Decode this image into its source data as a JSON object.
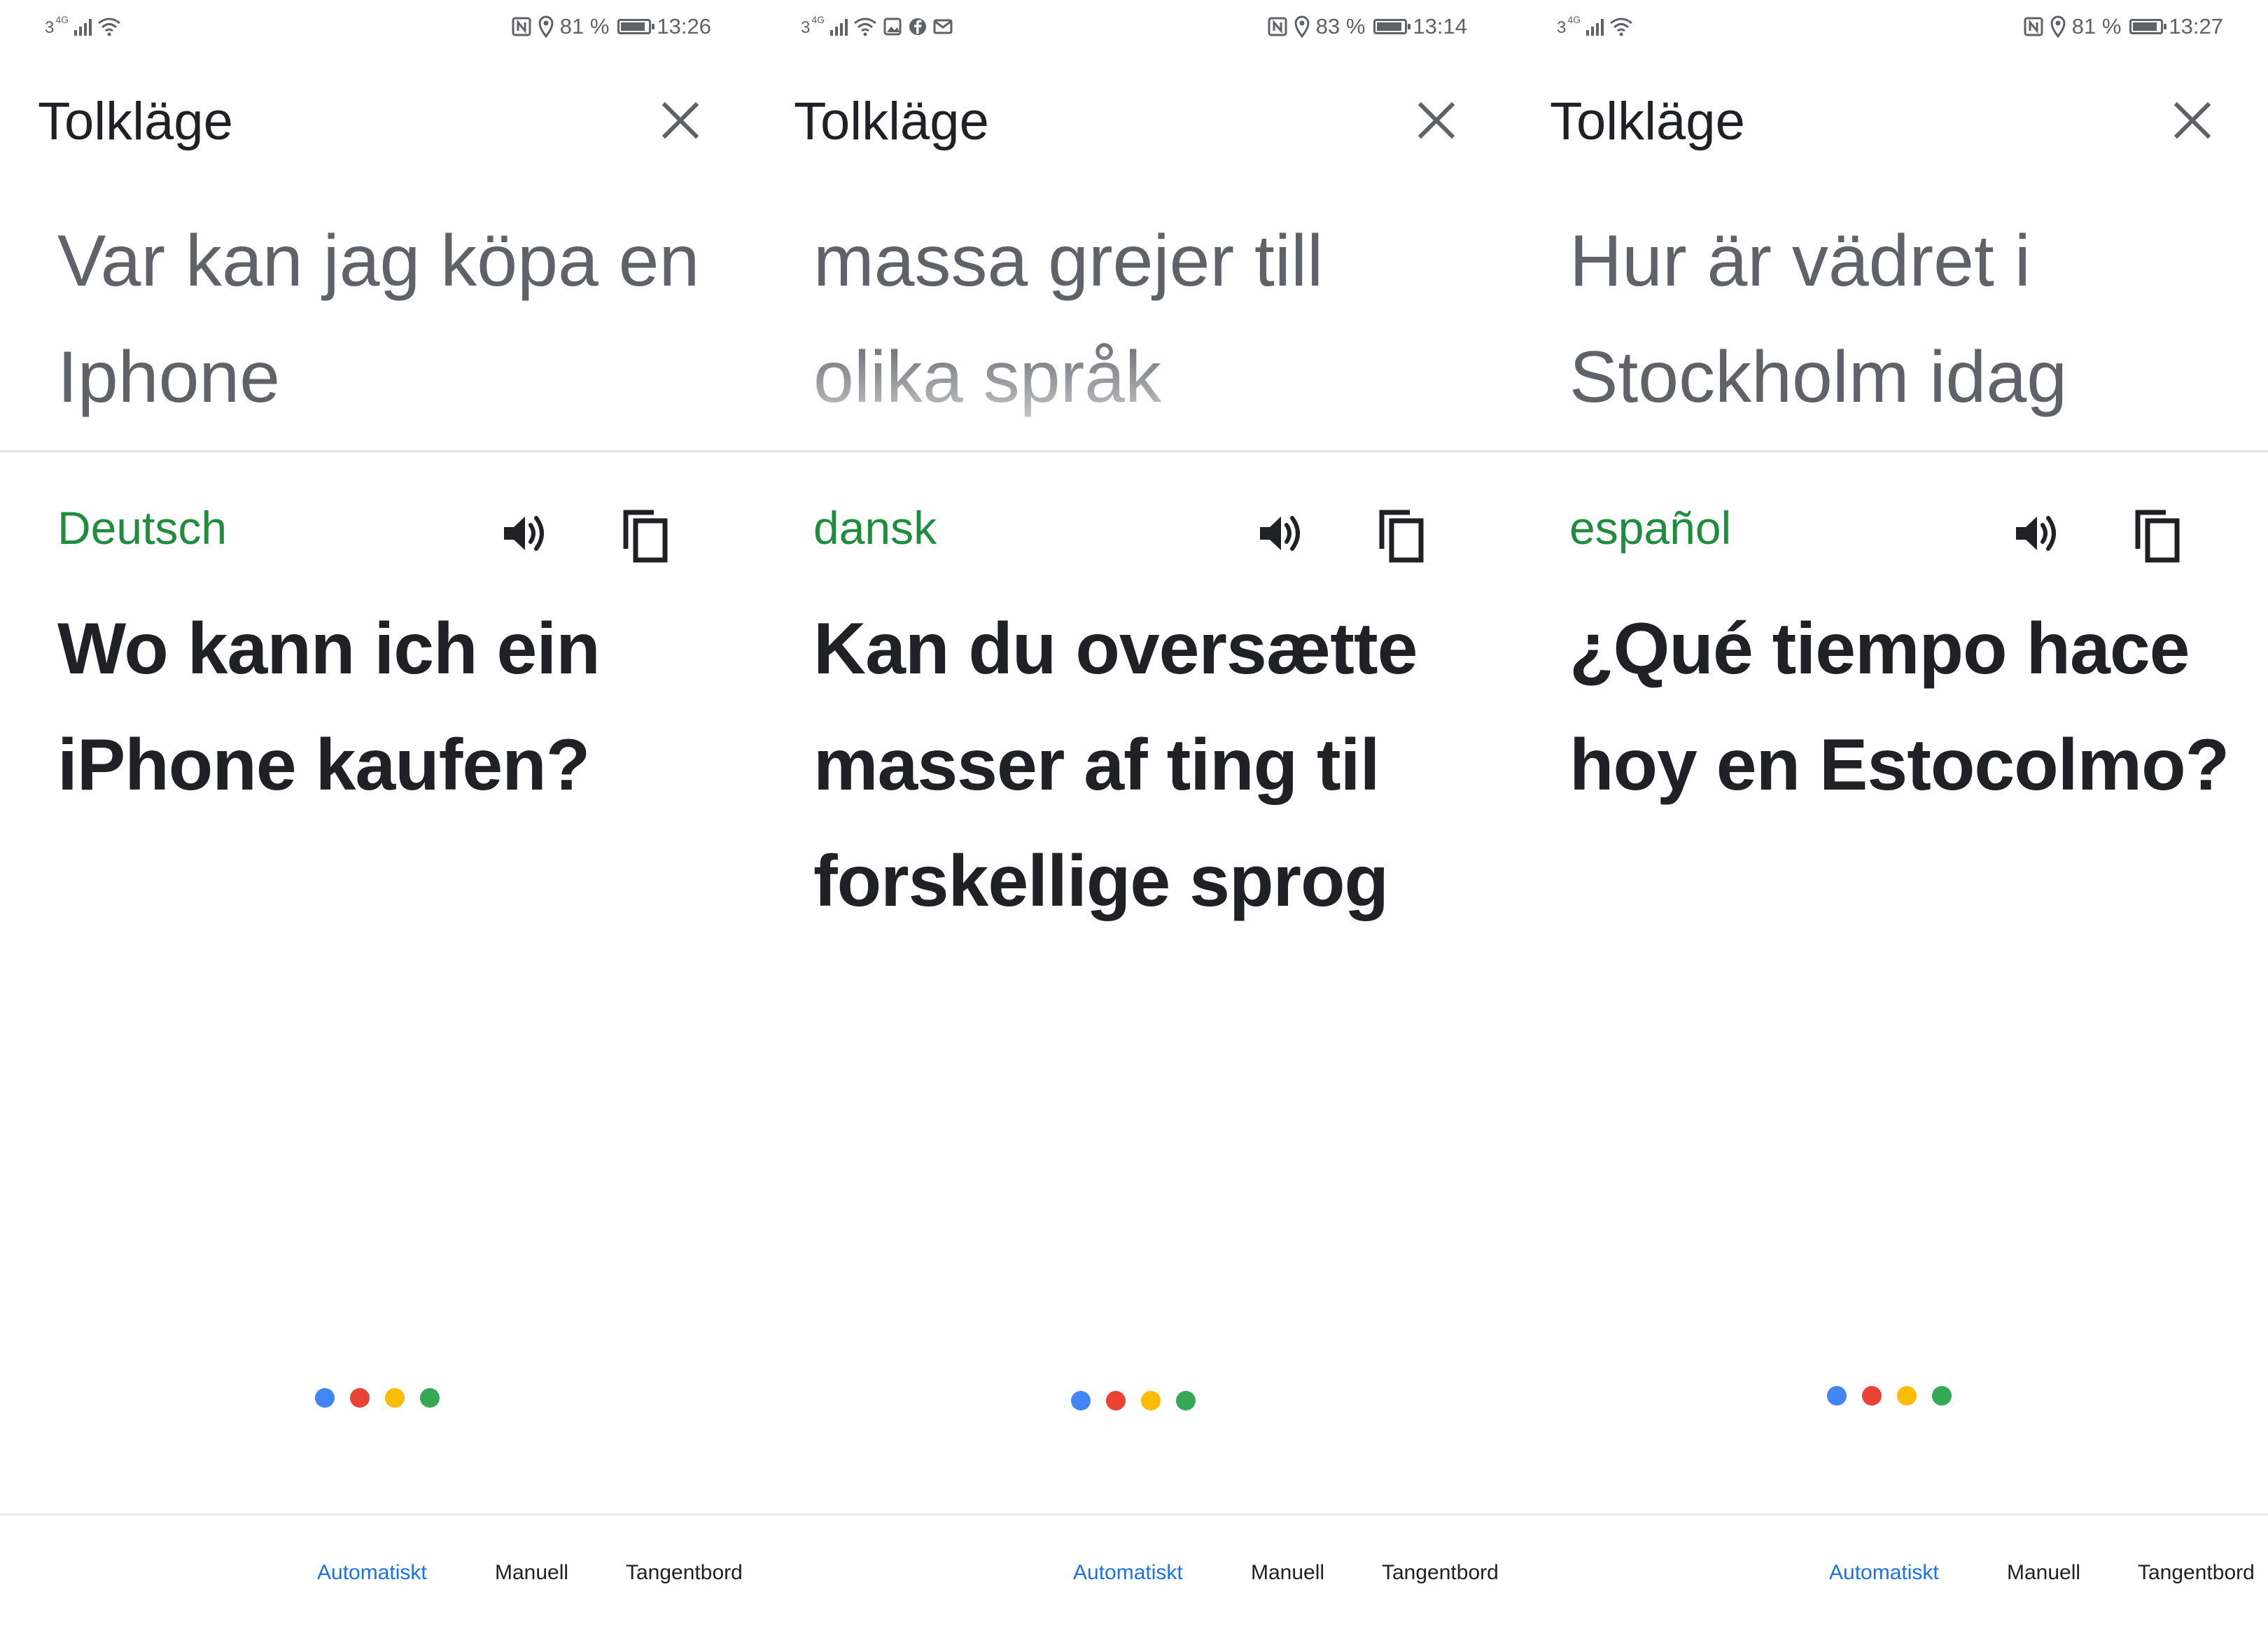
{
  "colors": {
    "accent_blue": "#1a73e8",
    "language_green": "#1e8e3e",
    "source_gray": "#5f6368",
    "dot_blue": "#4285f4",
    "dot_red": "#ea4335",
    "dot_yellow": "#fbbc04",
    "dot_green": "#34a853"
  },
  "panels": [
    {
      "status": {
        "network": "3",
        "network_type": "4G",
        "battery": "81 %",
        "battery_level": 0.81,
        "time": "13:26",
        "extra_icons": []
      },
      "title": "Tolkläge",
      "close_icon": "close-icon",
      "source_text": "Var kan jag köpa en\nIphone",
      "language": "Deutsch",
      "translation": "Wo kann ich ein\niPhone kaufen?",
      "tabs": [
        "Automatiskt",
        "Manuell",
        "Tangentbord"
      ],
      "active_tab": "Automatiskt"
    },
    {
      "status": {
        "network": "3",
        "network_type": "4G",
        "battery": "83 %",
        "battery_level": 0.83,
        "time": "13:14",
        "extra_icons": [
          "gallery-icon",
          "facebook-icon",
          "mail-icon"
        ]
      },
      "title": "Tolkläge",
      "close_icon": "close-icon",
      "source_text": "massa grejer till\nolika språk",
      "language": "dansk",
      "translation": "Kan du oversætte\nmasser af ting til\nforskellige sprog",
      "tabs": [
        "Automatiskt",
        "Manuell",
        "Tangentbord"
      ],
      "active_tab": "Automatiskt"
    },
    {
      "status": {
        "network": "3",
        "network_type": "4G",
        "battery": "81 %",
        "battery_level": 0.81,
        "time": "13:27",
        "extra_icons": []
      },
      "title": "Tolkläge",
      "close_icon": "close-icon",
      "source_text": "Hur är vädret i\nStockholm idag",
      "language": "español",
      "translation": "¿Qué tiempo hace\nhoy en Estocolmo?",
      "tabs": [
        "Automatiskt",
        "Manuell",
        "Tangentbord"
      ],
      "active_tab": "Automatiskt"
    }
  ]
}
